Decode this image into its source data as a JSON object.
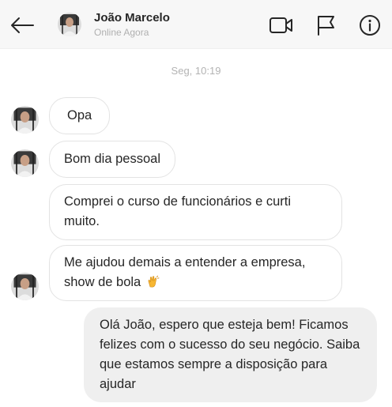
{
  "header": {
    "contact_name": "João Marcelo",
    "contact_status": "Online Agora",
    "icons": {
      "back": "arrow-left-icon",
      "video": "video-camera-icon",
      "report": "flag-icon",
      "info": "info-icon"
    }
  },
  "conversation": {
    "timestamp": "Seg, 10:19",
    "incoming": [
      {
        "text": "Opa"
      },
      {
        "text": "Bom dia pessoal"
      },
      {
        "text": "Comprei o curso de funcionários e curti muito."
      },
      {
        "text": "Me ajudou demais a entender a empresa, show de bola",
        "emoji": "clapping-hands-icon"
      }
    ],
    "outgoing": [
      {
        "text": "Olá João, espero que esteja bem! Ficamos felizes com o sucesso do seu negócio. Saiba que estamos sempre a disposição para ajudar"
      }
    ]
  },
  "colors": {
    "header_bg": "#f7f7f7",
    "incoming_border": "#e3e3e3",
    "outgoing_bg": "#efefef",
    "muted_text": "#b3b3b3",
    "emoji": "#f7b733"
  }
}
